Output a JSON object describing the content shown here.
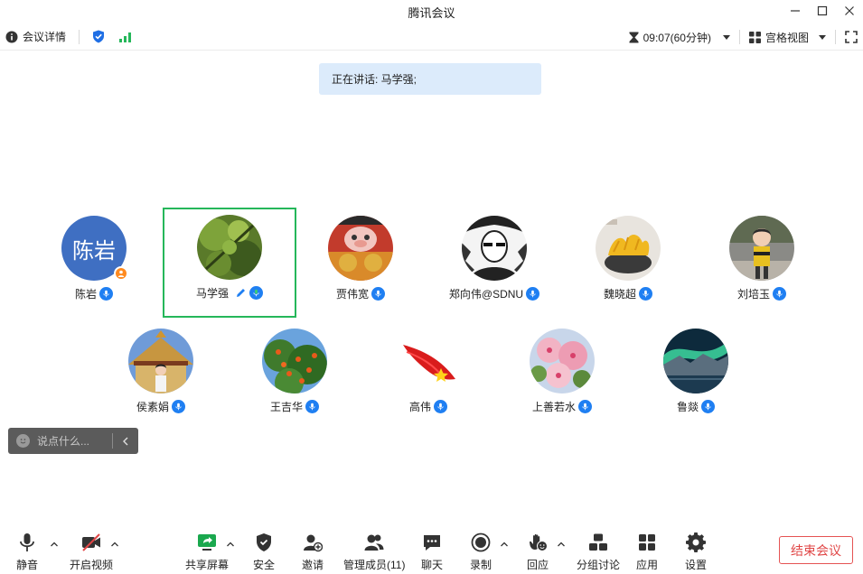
{
  "window": {
    "title": "腾讯会议"
  },
  "infobar": {
    "meeting_details": "会议详情",
    "timer": "09:07(60分钟)",
    "view_mode": "宫格视图"
  },
  "speaking": {
    "text": "正在讲话: 马学强;"
  },
  "participants": [
    {
      "name": "陈岩",
      "avatar_text": "陈岩"
    },
    {
      "name": "马学强"
    },
    {
      "name": "贾伟宽"
    },
    {
      "name": "郑向伟@SDNU"
    },
    {
      "name": "魏晓超"
    },
    {
      "name": "刘培玉"
    },
    {
      "name": "侯素娟"
    },
    {
      "name": "王吉华"
    },
    {
      "name": "高伟"
    },
    {
      "name": "上善若水"
    },
    {
      "name": "鲁燚"
    }
  ],
  "chat": {
    "placeholder": "说点什么..."
  },
  "toolbar": {
    "mute": "静音",
    "video": "开启视频",
    "share": "共享屏幕",
    "security": "安全",
    "invite": "邀请",
    "members": "管理成员(11)",
    "chat": "聊天",
    "record": "录制",
    "react": "回应",
    "breakout": "分组讨论",
    "apps": "应用",
    "settings": "设置",
    "end": "结束会议"
  },
  "colors": {
    "accent": "#1f7ff2",
    "active_border": "#25b75a",
    "end_red": "#e04646",
    "host_orange": "#ff8a1f",
    "avatar_blue": "#3f6fc2"
  }
}
